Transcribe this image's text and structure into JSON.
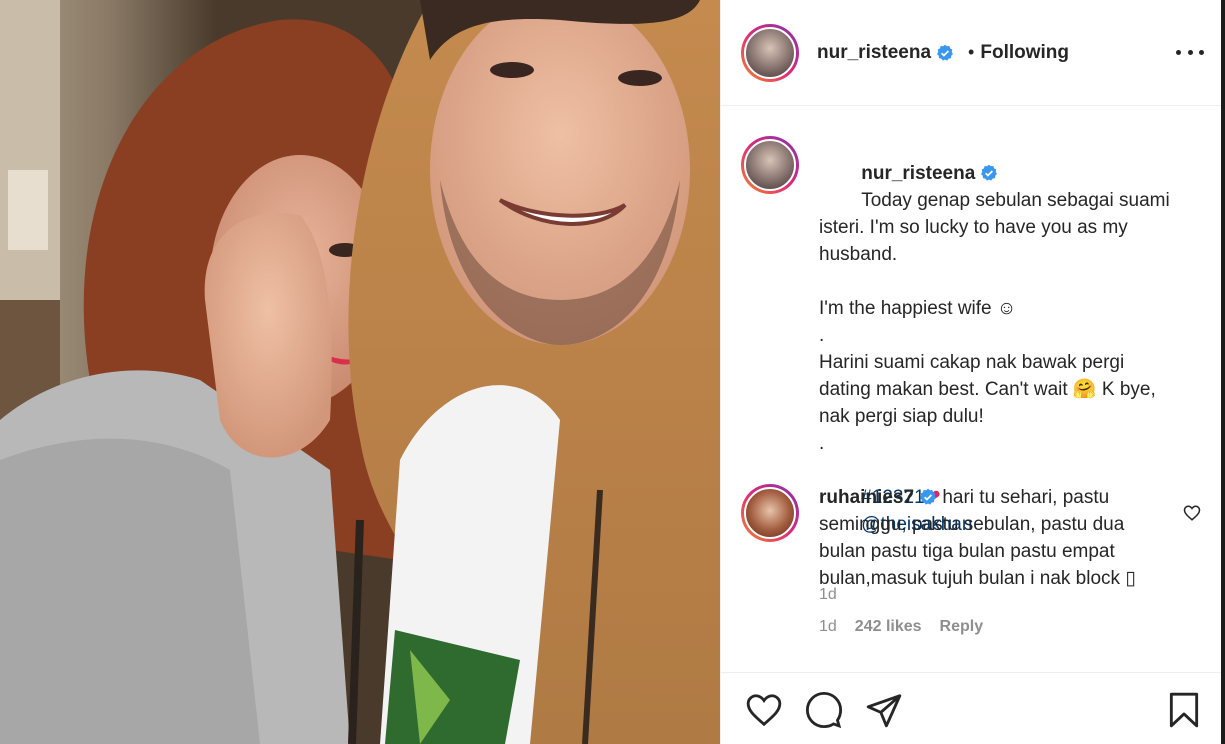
{
  "post": {
    "photo_icon": "couple-selfie-photo"
  },
  "header": {
    "username": "nur_risteena",
    "separator": "•",
    "follow_status": "Following",
    "verified_icon": "verified-badge-icon",
    "more_icon": "more-options-icon"
  },
  "caption": {
    "username": "nur_risteena",
    "line1": "Today genap sebulan sebagai suami isteri. I'm so lucky to have you as my husband.",
    "line2": "I'm the happiest wife ☺",
    "dot1": ".",
    "line3": "Harini suami cakap nak bawak pergi dating makan best. Can't wait 🤗 K bye, nak pergi siap dulu!",
    "dot2": ".",
    "hashtag": "#12321",
    "heart": "❤",
    "mention": "@theisakhan",
    "time": "1d"
  },
  "comment": {
    "username": "ruhainies7",
    "text": "hari tu sehari, pastu seminggu, pastu sebulan, pastu dua bulan pastu tiga bulan pastu empat bulan,masuk tujuh bulan i nak block ▯",
    "time": "1d",
    "likes": "242 likes",
    "reply": "Reply"
  },
  "actions": {
    "like_icon": "heart-icon",
    "comment_icon": "comment-icon",
    "share_icon": "share-icon",
    "save_icon": "bookmark-icon"
  },
  "colors": {
    "link": "#00376b",
    "muted": "#8e8e8e",
    "verified": "#3897f0"
  }
}
